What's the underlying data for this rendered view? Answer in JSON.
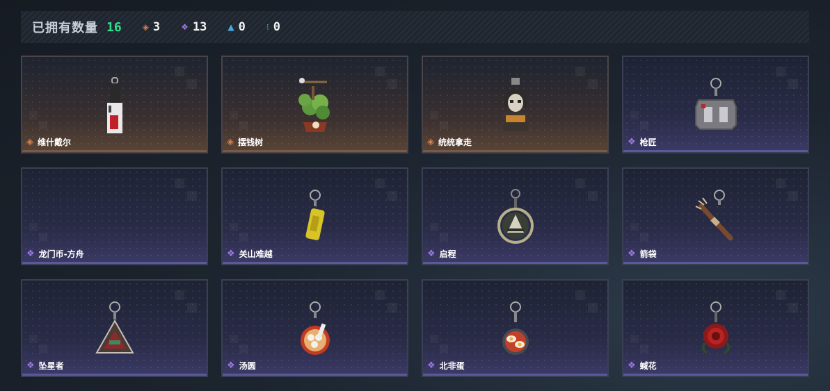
{
  "summary": {
    "owned_label": "已拥有数量",
    "owned_count": "16",
    "stats": [
      {
        "icon": "diamond-orange-icon",
        "glyph": "◈",
        "color": "#d7824a",
        "value": "3"
      },
      {
        "icon": "clover-purple-icon",
        "glyph": "❖",
        "color": "#9b7be0",
        "value": "13"
      },
      {
        "icon": "triangles-blue-icon",
        "glyph": "▲",
        "color": "#4aa8e0",
        "value": "0"
      },
      {
        "icon": "dots-green-icon",
        "glyph": "⁝",
        "color": "#2fd58d",
        "value": "0"
      }
    ]
  },
  "items": [
    {
      "name": "维什戴尔",
      "rarity": "orange",
      "icon": "figure-charm-icon"
    },
    {
      "name": "摆钱树",
      "rarity": "orange",
      "icon": "money-tree-charm-icon"
    },
    {
      "name": "统统拿走",
      "rarity": "orange",
      "icon": "mask-figure-charm-icon"
    },
    {
      "name": "枪匠",
      "rarity": "purple",
      "icon": "armor-plate-charm-icon"
    },
    {
      "name": "龙门币-方舟",
      "rarity": "purple",
      "icon": ""
    },
    {
      "name": "关山难越",
      "rarity": "purple",
      "icon": "yellow-can-charm-icon"
    },
    {
      "name": "启程",
      "rarity": "purple",
      "icon": "ring-medal-charm-icon"
    },
    {
      "name": "箭袋",
      "rarity": "purple",
      "icon": "arrows-charm-icon"
    },
    {
      "name": "坠星者",
      "rarity": "purple",
      "icon": "triangle-badge-charm-icon"
    },
    {
      "name": "汤圆",
      "rarity": "purple",
      "icon": "dumpling-bowl-charm-icon"
    },
    {
      "name": "北非蛋",
      "rarity": "purple",
      "icon": "egg-pan-charm-icon"
    },
    {
      "name": "蜮花",
      "rarity": "purple",
      "icon": "red-rose-charm-icon"
    }
  ]
}
